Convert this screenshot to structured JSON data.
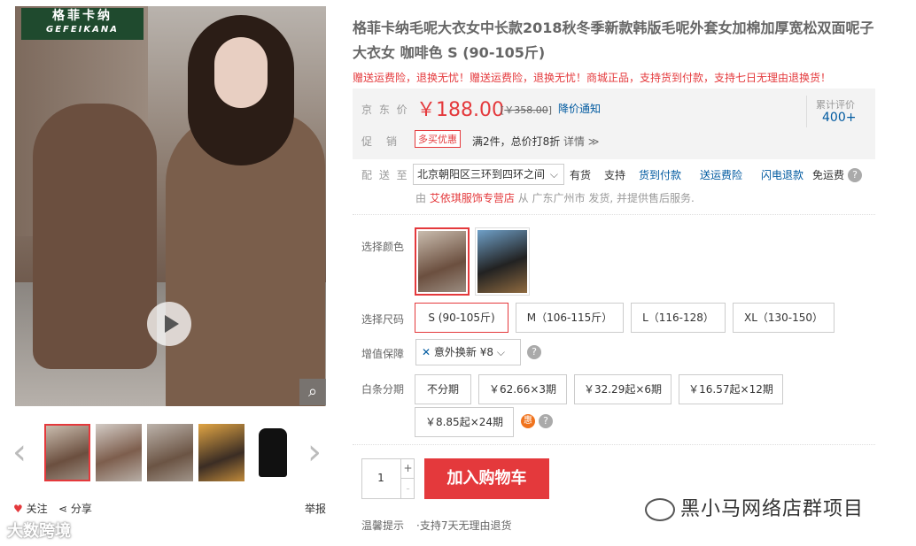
{
  "brand": {
    "logo_cn": "格菲卡纳",
    "logo_en": "GEFEIKANA"
  },
  "gallery": {
    "prev": "‹",
    "next": "›",
    "follow": "关注",
    "share": "分享",
    "report": "举报",
    "zoom": "⌕",
    "thumb_count": 5
  },
  "watermark_left": "大数跨境",
  "product": {
    "title": "格菲卡纳毛呢大衣女中长款2018秋冬季新款韩版毛呢外套女加棉加厚宽松双面呢子大衣女 咖啡色 S (90-105斤)",
    "promo_banner": "赠送运费险，退换无忧！赠送运费险，退换无忧！商城正品，支持货到付款，支持七日无理由退换货！"
  },
  "price": {
    "label": "京 东 价",
    "current": "￥188.00",
    "original": "￥358.00",
    "notify": "降价通知",
    "review_label": "累计评价",
    "review_count": "400+"
  },
  "promotion": {
    "label": "促　销",
    "tag": "多买优惠",
    "text": "满2件，总价打8折",
    "more": "详情 ≫"
  },
  "shipping": {
    "label": "配 送 至",
    "address": "北京朝阳区三环到四环之间",
    "stock": "有货",
    "items": [
      "支持",
      "货到付款",
      "送运费险",
      "闪电退款",
      "免运费"
    ],
    "shop_from": "由",
    "shop_name": "艾依琪服饰专营店",
    "shop_rest": "从 广东广州市 发货, 并提供售后服务."
  },
  "color": {
    "label": "选择颜色"
  },
  "size": {
    "label": "选择尺码",
    "options": [
      "S (90-105斤)",
      "M（106-115斤）",
      "L（116-128）",
      "XL（130-150）"
    ]
  },
  "insurance": {
    "label": "增值保障",
    "value": "意外换新 ¥8"
  },
  "installment": {
    "label": "白条分期",
    "options": [
      "不分期",
      "￥62.66×3期",
      "￥32.29起×6期",
      "￥16.57起×12期",
      "￥8.85起×24期"
    ],
    "hui": "惠"
  },
  "cart": {
    "qty": "1",
    "plus": "+",
    "minus": "-",
    "button": "加入购物车"
  },
  "tip": {
    "label": "温馨提示",
    "text": "·支持7天无理由退货"
  },
  "watermark_right": "黑小马网络店群项目",
  "help": "?",
  "colors": {
    "accent": "#e4393c",
    "link": "#005aa0"
  }
}
